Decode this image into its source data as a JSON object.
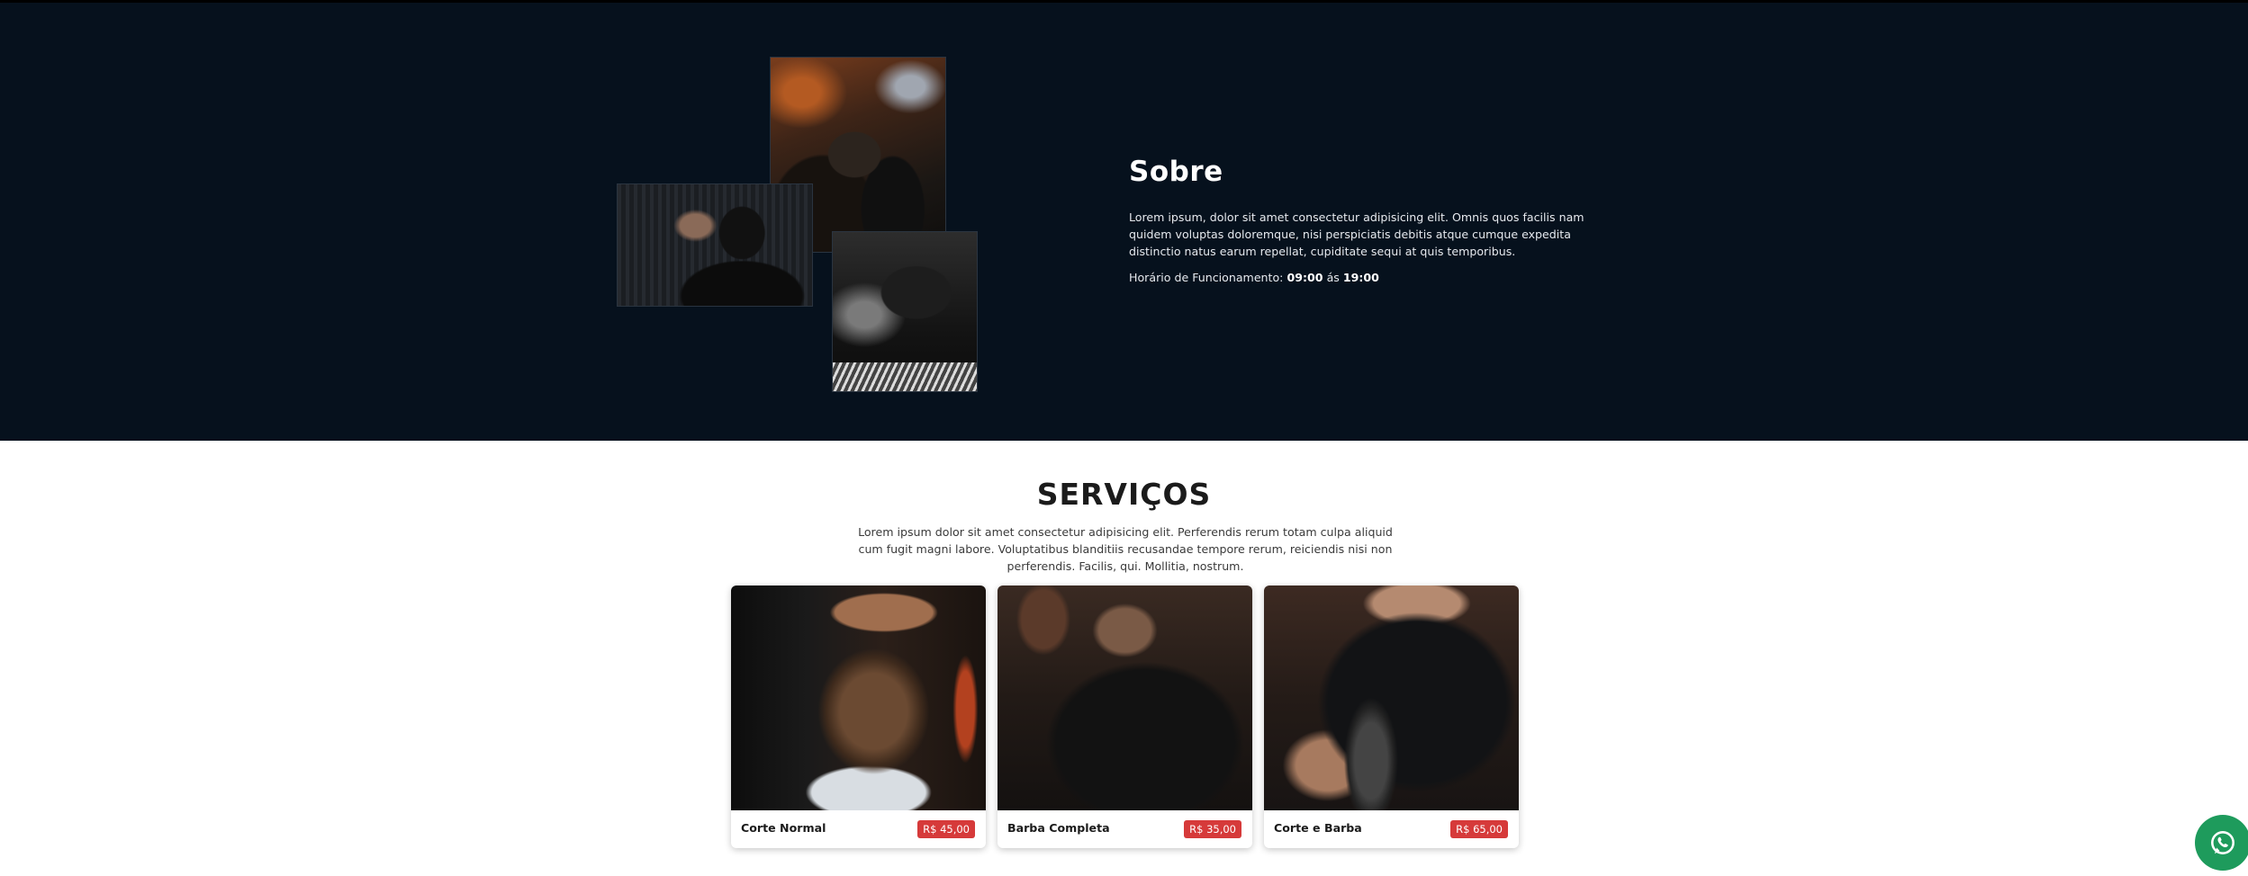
{
  "about": {
    "title": "Sobre",
    "text": "Lorem ipsum, dolor sit amet consectetur adipisicing elit. Omnis quos facilis nam quidem voluptas doloremque, nisi perspiciatis debitis atque cumque expedita distinctio natus earum repellat, cupiditate sequi at quis temporibus.",
    "hours_label": "Horário de Funcionamento:",
    "hours_open": "09:00",
    "hours_sep": "ás",
    "hours_close": "19:00"
  },
  "services": {
    "title": "SERVIÇOS",
    "text": "Lorem ipsum dolor sit amet consectetur adipisicing elit. Perferendis rerum totam culpa aliquid cum fugit magni labore. Voluptatibus blanditiis recusandae tempore rerum, reiciendis nisi non perferendis. Facilis, qui. Mollitia, nostrum.",
    "cards": [
      {
        "name": "Corte Normal",
        "price": "R$ 45,00"
      },
      {
        "name": "Barba Completa",
        "price": "R$ 35,00"
      },
      {
        "name": "Corte e Barba",
        "price": "R$ 65,00"
      }
    ]
  },
  "floating": {
    "icon": "whatsapp-icon",
    "color": "#1e9b5c"
  },
  "colors": {
    "about_bg": "#06111d",
    "price_badge": "#d63a3a"
  }
}
